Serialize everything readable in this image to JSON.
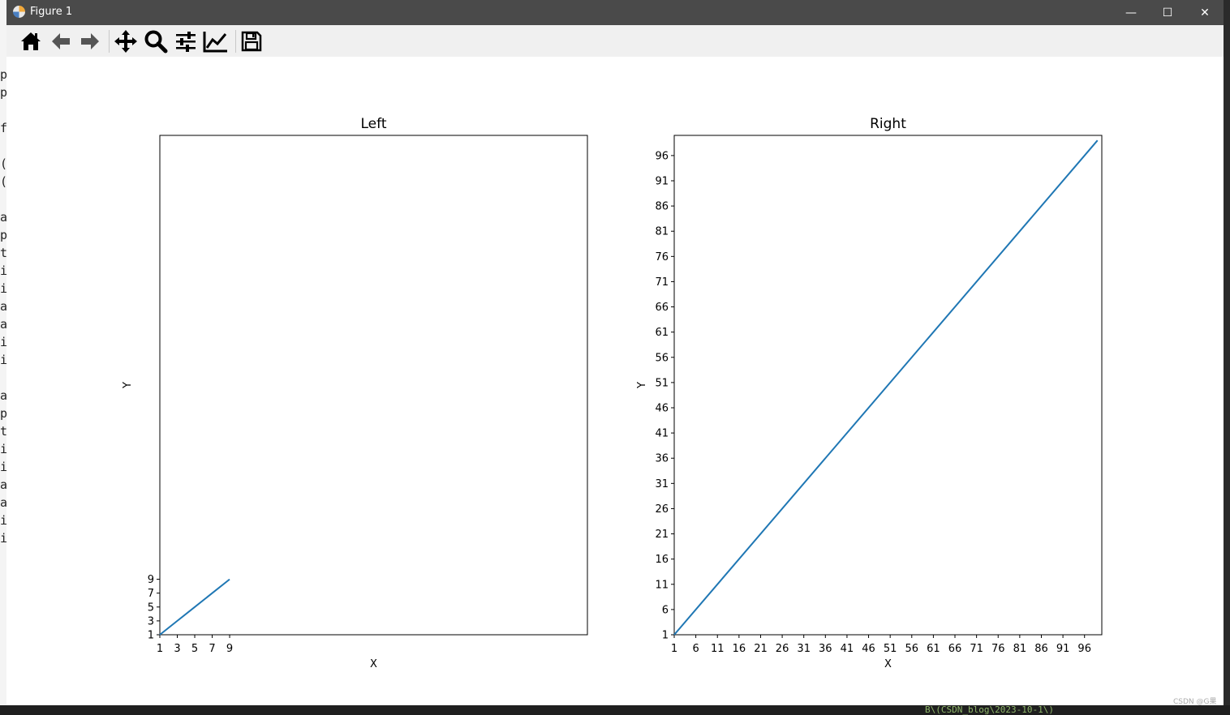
{
  "window": {
    "title": "Figure 1",
    "minimize_glyph": "—",
    "maximize_glyph": "☐",
    "close_glyph": "✕"
  },
  "toolbar": {
    "buttons": [
      {
        "name": "home-icon",
        "label": "Home"
      },
      {
        "name": "back-arrow-icon",
        "label": "Back"
      },
      {
        "name": "forward-arrow-icon",
        "label": "Forward"
      },
      {
        "name": "pan-move-icon",
        "label": "Pan"
      },
      {
        "name": "zoom-magnifier-icon",
        "label": "Zoom"
      },
      {
        "name": "configure-subplots-icon",
        "label": "Subplots"
      },
      {
        "name": "edit-axis-icon",
        "label": "Customize"
      },
      {
        "name": "save-disk-icon",
        "label": "Save"
      }
    ]
  },
  "colors": {
    "line": "#1f77b4",
    "titlebar": "#4a4a4a",
    "toolbar": "#f0f0f0"
  },
  "chart_data": [
    {
      "type": "line",
      "title": "Left",
      "xlabel": "X",
      "ylabel": "Y",
      "xlim": [
        1,
        50
      ],
      "ylim": [
        1,
        73
      ],
      "x": [
        1,
        3,
        5,
        7,
        9
      ],
      "y": [
        1,
        3,
        5,
        7,
        9
      ],
      "xticks": [
        1,
        3,
        5,
        7,
        9
      ],
      "yticks": [
        1,
        3,
        5,
        7,
        9
      ],
      "grid": false
    },
    {
      "type": "line",
      "title": "Right",
      "xlabel": "X",
      "ylabel": "Y",
      "xlim": [
        1,
        100
      ],
      "ylim": [
        1,
        100
      ],
      "x": [
        1,
        99
      ],
      "y": [
        1,
        99
      ],
      "xticks": [
        1,
        6,
        11,
        16,
        21,
        26,
        31,
        36,
        41,
        46,
        51,
        56,
        61,
        66,
        71,
        76,
        81,
        86,
        91,
        96
      ],
      "yticks": [
        1,
        6,
        11,
        16,
        21,
        26,
        31,
        36,
        41,
        46,
        51,
        56,
        61,
        66,
        71,
        76,
        81,
        86,
        91,
        96
      ],
      "grid": false
    }
  ],
  "background": {
    "left_chars": [
      "p",
      "p",
      "f",
      "(",
      "(",
      "a",
      "p",
      "t",
      "i",
      "i",
      "a",
      "a",
      "i",
      "i",
      "a",
      "p",
      "t",
      "i",
      "i",
      "a",
      "a",
      "i",
      "i"
    ],
    "bottom_text": "B\\(CSDN_blog\\2023-10-1\\)",
    "watermark": "CSDN @G果"
  }
}
